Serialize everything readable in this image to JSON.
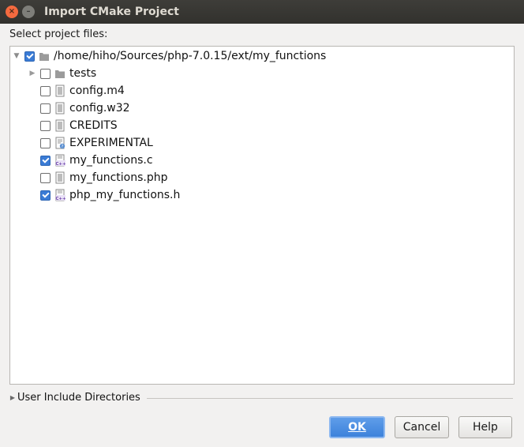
{
  "window": {
    "title": "Import CMake Project",
    "close_glyph": "×",
    "minimize_glyph": "–"
  },
  "tree": {
    "section_label": "Select project files:",
    "root": {
      "label": "/home/hiho/Sources/php-7.0.15/ext/my_functions",
      "checked": true,
      "expanded": true,
      "icon": "folder-icon"
    },
    "items": [
      {
        "label": "tests",
        "checked": false,
        "icon": "folder-icon",
        "expandable": true
      },
      {
        "label": "config.m4",
        "checked": false,
        "icon": "text-file-icon"
      },
      {
        "label": "config.w32",
        "checked": false,
        "icon": "text-file-icon"
      },
      {
        "label": "CREDITS",
        "checked": false,
        "icon": "text-file-icon"
      },
      {
        "label": "EXPERIMENTAL",
        "checked": false,
        "icon": "unknown-file-icon"
      },
      {
        "label": "my_functions.c",
        "checked": true,
        "icon": "cpp-file-icon"
      },
      {
        "label": "my_functions.php",
        "checked": false,
        "icon": "text-file-icon"
      },
      {
        "label": "php_my_functions.h",
        "checked": true,
        "icon": "cpp-file-icon"
      }
    ]
  },
  "include_dirs": {
    "label": "User Include Directories",
    "expanded": false
  },
  "buttons": {
    "ok": "OK",
    "cancel": "Cancel",
    "help": "Help"
  },
  "colors": {
    "accent": "#3a7bd5",
    "titlebar": "#3a3935",
    "close": "#f46a3f"
  }
}
